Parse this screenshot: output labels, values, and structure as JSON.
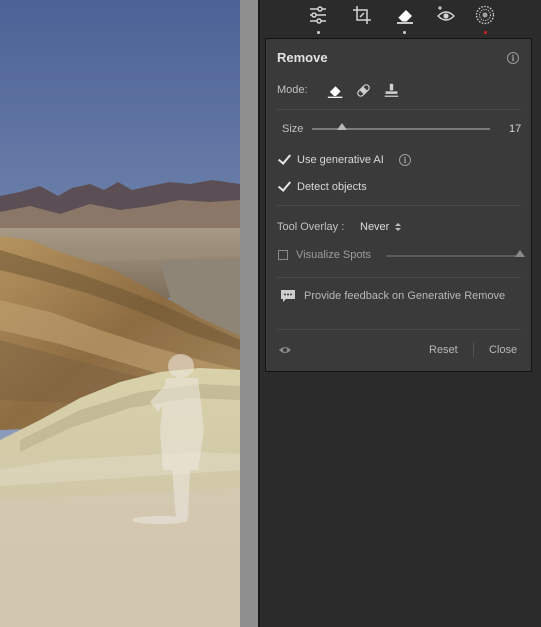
{
  "toolstrip": {
    "tools": [
      {
        "icon": "sliders-icon",
        "active": false
      },
      {
        "icon": "crop-icon",
        "active": false
      },
      {
        "icon": "eraser-icon",
        "active": true
      },
      {
        "icon": "red-eye-icon",
        "active": false
      },
      {
        "icon": "masking-icon",
        "active": false
      }
    ]
  },
  "panel": {
    "title": "Remove",
    "mode_label": "Mode:",
    "modes": [
      "remove-eraser-icon",
      "heal-bandage-icon",
      "clone-stamp-icon"
    ],
    "size": {
      "label": "Size",
      "value": "17",
      "level": 0.17
    },
    "use_generative_ai": {
      "label": "Use generative AI",
      "checked": true
    },
    "detect_objects": {
      "label": "Detect objects",
      "checked": true
    },
    "tool_overlay": {
      "label": "Tool Overlay :",
      "value": "Never"
    },
    "visualize_spots": {
      "label": "Visualize Spots",
      "checked": false,
      "level": 1.0
    },
    "feedback": {
      "text": "Provide feedback on Generative Remove"
    },
    "reset_label": "Reset",
    "close_label": "Close"
  },
  "colors": {
    "panel_bg": "#3a3a3a",
    "app_bg": "#2b2b2b",
    "active_dot": "#d21f1f",
    "text": "#d8d8d8"
  }
}
